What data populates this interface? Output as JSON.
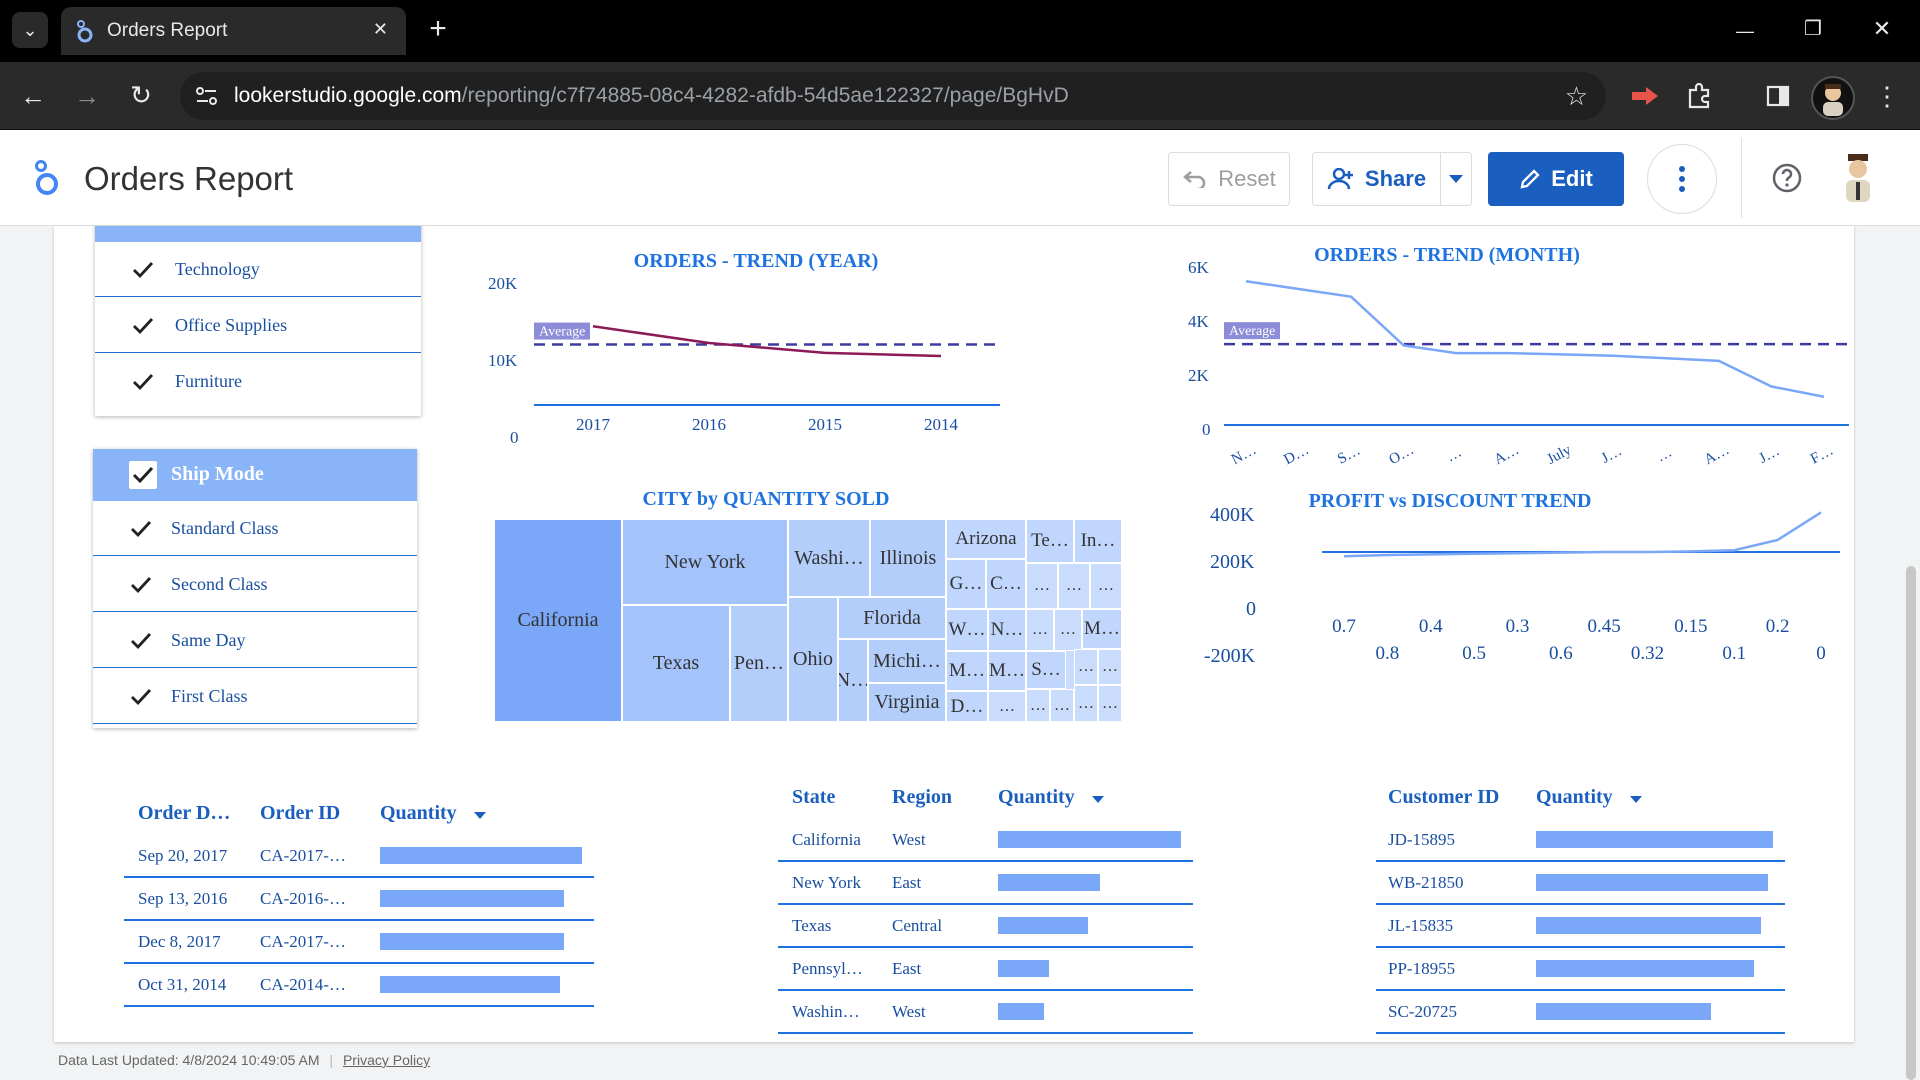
{
  "browser": {
    "tab_title": "Orders Report",
    "url_domain": "lookerstudio.google.com",
    "url_path": "/reporting/c7f74885-08c4-4282-afdb-54d5ae122327/page/BgHvD",
    "tab_close": "✕",
    "new_tab": "+",
    "win_min": "—",
    "win_restore": "❐",
    "win_close": "✕",
    "back": "←",
    "forward": "→",
    "reload": "↻",
    "star": "☆",
    "menu": "⋮",
    "dropdown": "⌄"
  },
  "header": {
    "title": "Orders Report",
    "reset_label": "Reset",
    "share_label": "Share",
    "edit_label": "Edit",
    "accent": "#1a5fc0"
  },
  "filters": {
    "category": {
      "items": [
        "Technology",
        "Office Supplies",
        "Furniture"
      ]
    },
    "ship_mode": {
      "title": "Ship Mode",
      "items": [
        "Standard Class",
        "Second Class",
        "Same Day",
        "First Class"
      ]
    }
  },
  "charts": {
    "year": {
      "title": "ORDERS - TREND (YEAR)",
      "avg_label": "Average",
      "y_ticks": [
        "20K",
        "10K",
        "0"
      ]
    },
    "month": {
      "title": "ORDERS - TREND (MONTH)",
      "avg_label": "Average",
      "y_ticks": [
        "6K",
        "4K",
        "2K",
        "0"
      ]
    },
    "city": {
      "title": "CITY by QUANTITY SOLD"
    },
    "profit": {
      "title": "PROFIT vs DISCOUNT TREND",
      "y_ticks": [
        "400K",
        "200K",
        "0",
        "-200K"
      ]
    }
  },
  "chart_data": [
    {
      "type": "line",
      "title": "ORDERS - TREND (YEAR)",
      "categories": [
        "2017",
        "2016",
        "2015",
        "2014"
      ],
      "series": [
        {
          "values": [
            12700,
            10000,
            8400,
            7900
          ]
        }
      ],
      "average": 9750,
      "ylim": [
        0,
        20000
      ],
      "y_ticks": [
        0,
        10000,
        20000
      ]
    },
    {
      "type": "line",
      "title": "ORDERS - TREND (MONTH)",
      "categories": [
        "N…",
        "D…",
        "S…",
        "O…",
        "…",
        "A…",
        "July",
        "J…",
        "…",
        "A…",
        "J…",
        "F…"
      ],
      "series": [
        {
          "values": [
            5600,
            5300,
            5000,
            3100,
            2800,
            2800,
            2750,
            2700,
            2600,
            2500,
            1500,
            1100
          ]
        }
      ],
      "average": 3150,
      "ylim": [
        0,
        6000
      ],
      "y_ticks": [
        0,
        2000,
        4000,
        6000
      ]
    },
    {
      "type": "heatmap",
      "title": "CITY by QUANTITY SOLD",
      "labels": [
        "California",
        "New York",
        "Texas",
        "Pen…",
        "Washi…",
        "Illinois",
        "Ohio",
        "Florida",
        "N…",
        "Michi…",
        "Virginia",
        "Arizona",
        "Te…",
        "In…",
        "G…",
        "C…",
        "W…",
        "N…",
        "M…",
        "M…",
        "D…",
        "S…",
        "M…"
      ]
    },
    {
      "type": "line",
      "title": "PROFIT vs DISCOUNT TREND",
      "categories": [
        "0.7",
        "0.8",
        "0.4",
        "0.5",
        "0.3",
        "0.6",
        "0.45",
        "0.32",
        "0.15",
        "0.1",
        "0.2",
        "0"
      ],
      "series": [
        {
          "values": [
            -35000,
            -25000,
            -20000,
            -15000,
            -10000,
            -5000,
            0,
            0,
            5000,
            15000,
            100000,
            330000
          ]
        }
      ],
      "ylim": [
        -200000,
        400000
      ],
      "y_ticks": [
        -200000,
        0,
        200000,
        400000
      ]
    }
  ],
  "tables": {
    "orders": {
      "headers": [
        "Order D…",
        "Order ID",
        "Quantity"
      ],
      "rows": [
        {
          "date": "Sep 20, 2017",
          "id": "CA-2017-…",
          "qty": 1.0
        },
        {
          "date": "Sep 13, 2016",
          "id": "CA-2016-…",
          "qty": 0.91
        },
        {
          "date": "Dec 8, 2017",
          "id": "CA-2017-…",
          "qty": 0.91
        },
        {
          "date": "Oct 31, 2014",
          "id": "CA-2014-…",
          "qty": 0.89
        }
      ]
    },
    "states": {
      "headers": [
        "State",
        "Region",
        "Quantity"
      ],
      "rows": [
        {
          "state": "California",
          "region": "West",
          "qty": 1.0
        },
        {
          "state": "New York",
          "region": "East",
          "qty": 0.56
        },
        {
          "state": "Texas",
          "region": "Central",
          "qty": 0.49
        },
        {
          "state": "Pennsyl…",
          "region": "East",
          "qty": 0.28
        },
        {
          "state": "Washin…",
          "region": "West",
          "qty": 0.25
        }
      ]
    },
    "customers": {
      "headers": [
        "Customer ID",
        "Quantity"
      ],
      "rows": [
        {
          "id": "JD-15895",
          "qty": 1.0
        },
        {
          "id": "WB-21850",
          "qty": 0.98
        },
        {
          "id": "JL-15835",
          "qty": 0.95
        },
        {
          "id": "PP-18955",
          "qty": 0.92
        },
        {
          "id": "SC-20725",
          "qty": 0.74
        }
      ]
    }
  },
  "footer": {
    "updated": "Data Last Updated: 4/8/2024 10:49:05 AM",
    "privacy": "Privacy Policy"
  }
}
